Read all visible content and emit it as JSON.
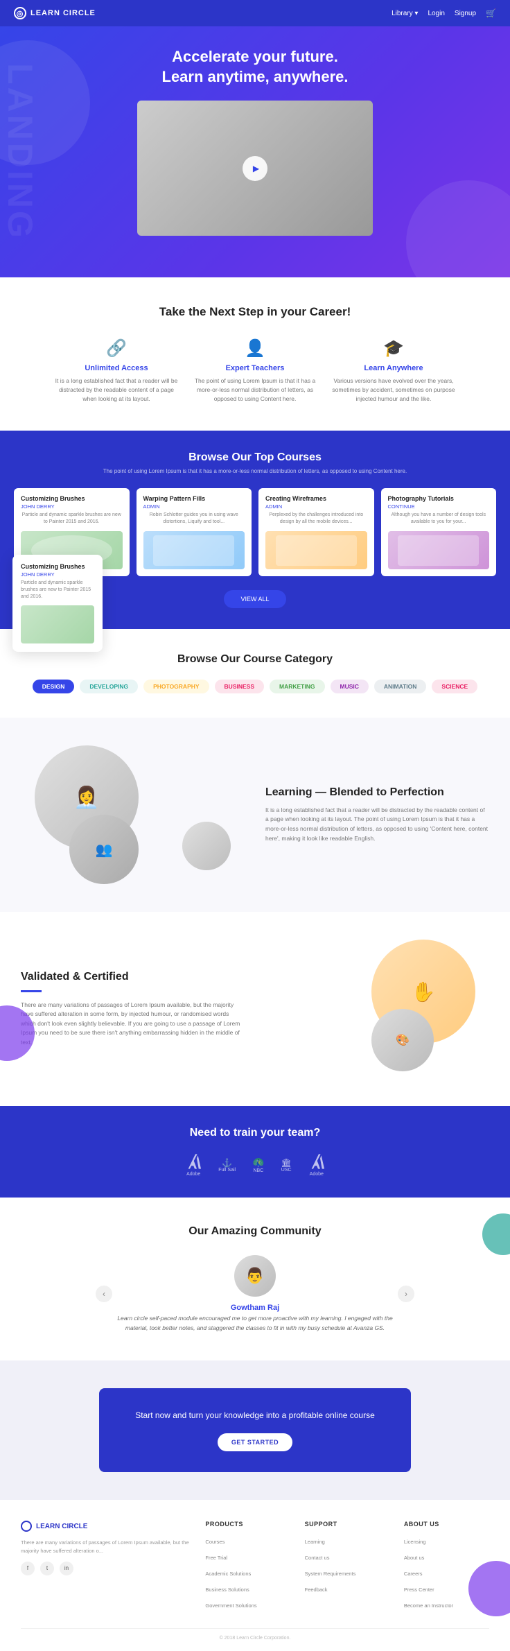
{
  "nav": {
    "logo_text": "LEARN CIRCLE",
    "links": [
      "Library ▾",
      "Login",
      "Signup"
    ],
    "cart_icon": "🛒"
  },
  "hero": {
    "title_line1": "Accelerate your future.",
    "title_line2": "Learn anytime, anywhere.",
    "landing_bg_text": "LANDING"
  },
  "next_step": {
    "title": "Take the Next Step in your Career!",
    "features": [
      {
        "icon": "🔗",
        "title": "Unlimited Access",
        "description": "It is a long established fact that a reader will be distracted by the readable content of a page when looking at its layout."
      },
      {
        "icon": "👤",
        "title": "Expert Teachers",
        "description": "The point of using Lorem Ipsum is that it has a more-or-less normal distribution of letters, as opposed to using Content here."
      },
      {
        "icon": "🎓",
        "title": "Learn Anywhere",
        "description": "Various versions have evolved over the years, sometimes by accident, sometimes on purpose injected humour and the like."
      }
    ]
  },
  "courses": {
    "section_title": "Browse Our Top Courses",
    "section_subtitle": "The point of using Lorem Ipsum is that it has a more-or-less normal distribution of letters, as opposed to using Content here.",
    "view_all_label": "VIEW ALL",
    "items": [
      {
        "title": "Customizing Brushes",
        "author": "JOHN DERRY",
        "description": "Particle and dynamic sparkle brushes are new to Painter 2015 and 2016.",
        "thumb_color": "green"
      },
      {
        "title": "Warping Pattern Fills",
        "author": "ADMIN",
        "description": "Robin Schlotter guides you in using wave distortions, Liquify and tool...",
        "thumb_color": "blue"
      },
      {
        "title": "Creating Wireframes",
        "author": "ADMIN",
        "description": "Perplexed by the challenges introduced into design by all the mobile devices...",
        "thumb_color": "orange"
      },
      {
        "title": "Photography Tutorials",
        "author": "CONTINUE",
        "description": "Although you have a number of design tools available to you for your...",
        "thumb_color": "purple"
      }
    ]
  },
  "popup": {
    "title": "Customizing Brushes",
    "author": "JOHN DERRY",
    "description": "Particle and dynamic sparkle brushes are new to Painter 2015 and 2016."
  },
  "categories": {
    "section_title": "Browse Our Course Category",
    "tags": [
      {
        "label": "DESIGN",
        "style": "blue"
      },
      {
        "label": "DEVELOPING",
        "style": "teal"
      },
      {
        "label": "PHOTOGRAPHY",
        "style": "yellow"
      },
      {
        "label": "BUSINESS",
        "style": "red"
      },
      {
        "label": "MARKETING",
        "style": "green"
      },
      {
        "label": "MUSIC",
        "style": "purple"
      },
      {
        "label": "ANIMATION",
        "style": "gray"
      },
      {
        "label": "SCIENCE",
        "style": "pink"
      }
    ]
  },
  "blended": {
    "title": "Learning — Blended to Perfection",
    "description": "It is a long established fact that a reader will be distracted by the readable content of a page when looking at its layout. The point of using Lorem Ipsum is that it has a more-or-less normal distribution of letters, as opposed to using 'Content here, content here', making it look like readable English."
  },
  "validated": {
    "title": "Validated & Certified",
    "description": "There are many variations of passages of Lorem Ipsum available, but the majority have suffered alteration in some form, by injected humour, or randomised words which don't look even slightly believable. If you are going to use a passage of Lorem Ipsum you need to be sure there isn't anything embarrassing hidden in the middle of text."
  },
  "train": {
    "title": "Need to train your team?",
    "brands": [
      "Adobe",
      "Full Sail",
      "NBC",
      "USC",
      "Adobe"
    ]
  },
  "community": {
    "title": "Our Amazing Community",
    "testimonial": {
      "name": "Gowtham Raj",
      "quote": "Learn circle self-paced module encouraged me to get more proactive with my learning. I engaged with the material, took better notes, and staggered the classes to fit in with my busy schedule at Avanza GS.",
      "prev": "‹",
      "next": "›"
    }
  },
  "cta": {
    "text": "Start now and turn your knowledge into a profitable online course",
    "button_label": "GET STARTED"
  },
  "footer": {
    "logo_text": "LEARN CIRCLE",
    "description": "There are many variations of passages of Lorem Ipsum available, but the majority have suffered alteration o...",
    "social": [
      "f",
      "t",
      "in"
    ],
    "columns": [
      {
        "title": "PRODUCTS",
        "links": [
          "Courses",
          "Free Trial",
          "Academic Solutions",
          "Business Solutions",
          "Government Solutions"
        ]
      },
      {
        "title": "SUPPORT",
        "links": [
          "Learning",
          "Contact us",
          "System Requirements",
          "Feedback"
        ]
      },
      {
        "title": "ABOUT US",
        "links": [
          "Licensing",
          "About us",
          "Careers",
          "Press Center",
          "Become an Instructor"
        ]
      }
    ],
    "copyright": "© 2018 Learn Circle Corporation."
  }
}
